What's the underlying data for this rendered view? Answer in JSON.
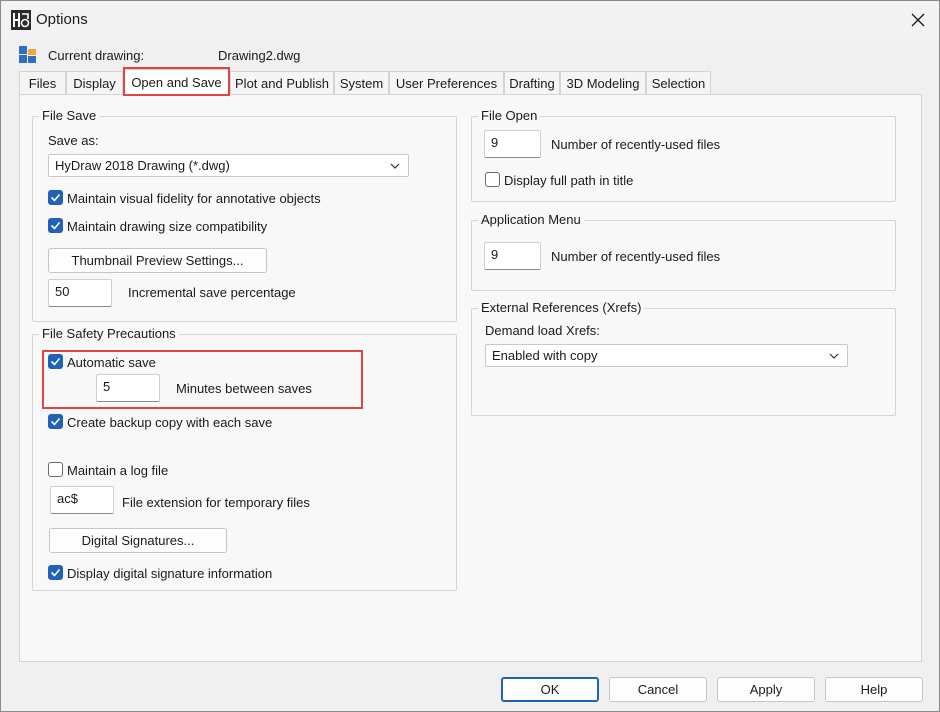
{
  "window": {
    "title": "Options",
    "close_icon": "close-icon"
  },
  "header": {
    "current_drawing_label": "Current drawing:",
    "current_drawing_value": "Drawing2.dwg"
  },
  "tabs": [
    {
      "label": "Files"
    },
    {
      "label": "Display"
    },
    {
      "label": "Open and Save",
      "active": true
    },
    {
      "label": "Plot and Publish"
    },
    {
      "label": "System"
    },
    {
      "label": "User Preferences"
    },
    {
      "label": "Drafting"
    },
    {
      "label": "3D Modeling"
    },
    {
      "label": "Selection"
    }
  ],
  "file_save": {
    "title": "File Save",
    "save_as_label": "Save as:",
    "save_as_value": "HyDraw 2018 Drawing (*.dwg)",
    "maintain_fidelity": {
      "label": "Maintain visual fidelity for annotative objects",
      "checked": true
    },
    "maintain_size": {
      "label": "Maintain drawing size compatibility",
      "checked": true
    },
    "thumbnail_button": "Thumbnail Preview Settings...",
    "incremental_value": "50",
    "incremental_label": "Incremental save percentage"
  },
  "file_safety": {
    "title": "File Safety Precautions",
    "automatic_save": {
      "label": "Automatic save",
      "checked": true
    },
    "minutes_value": "5",
    "minutes_label": "Minutes between saves",
    "backup_copy": {
      "label": "Create backup copy with each save",
      "checked": true
    },
    "log_file": {
      "label": "Maintain a log file",
      "checked": false
    },
    "temp_ext_value": "ac$",
    "temp_ext_label": "File extension for temporary files",
    "digital_signatures_button": "Digital Signatures...",
    "display_signature": {
      "label": "Display digital signature information",
      "checked": true
    }
  },
  "file_open": {
    "title": "File Open",
    "recent_value": "9",
    "recent_label": "Number of recently-used files",
    "full_path": {
      "label": "Display full path in title",
      "checked": false
    }
  },
  "app_menu": {
    "title": "Application Menu",
    "recent_value": "9",
    "recent_label": "Number of recently-used files"
  },
  "xrefs": {
    "title": "External References (Xrefs)",
    "demand_label": "Demand load Xrefs:",
    "demand_value": "Enabled with copy"
  },
  "footer": {
    "ok": "OK",
    "cancel": "Cancel",
    "apply": "Apply",
    "help": "Help"
  },
  "colors": {
    "accent": "#1f62b8",
    "highlight": "#e04444"
  }
}
